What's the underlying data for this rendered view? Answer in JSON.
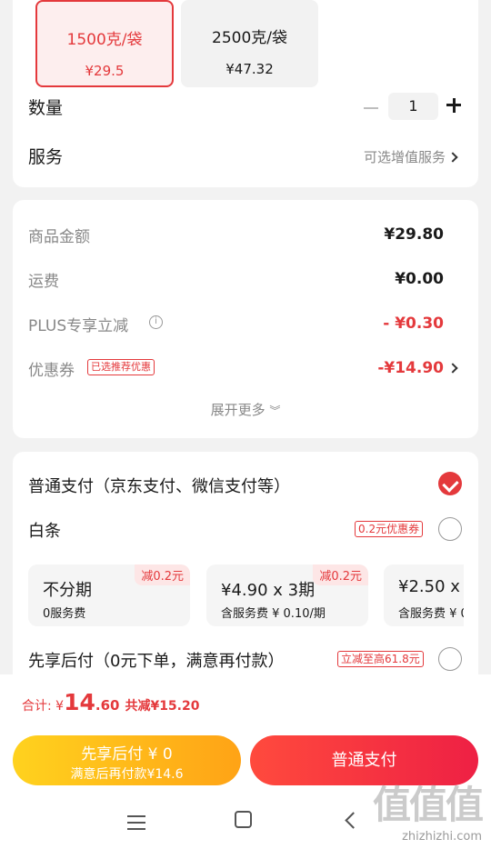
{
  "specs": [
    {
      "name": "1500克/袋",
      "price": "¥29.5",
      "selected": true
    },
    {
      "name": "2500克/袋",
      "price": "¥47.32",
      "selected": false
    }
  ],
  "quantity": {
    "label": "数量",
    "value": "1"
  },
  "service": {
    "label": "服务",
    "hint": "可选增值服务"
  },
  "price": {
    "goods_label": "商品金额",
    "goods_value": "¥29.80",
    "freight_label": "运费",
    "freight_value": "¥0.00",
    "plus_label": "PLUS专享立减",
    "plus_value": "- ¥0.30",
    "coupon_label": "优惠券",
    "coupon_tag": "已选推荐优惠",
    "coupon_value": "-¥14.90",
    "expand": "展开更多"
  },
  "payment": {
    "normal_label": "普通支付（京东支付、微信支付等）",
    "baitiao_label": "白条",
    "baitiao_tag": "0.2元优惠券",
    "installments": [
      {
        "title": "不分期",
        "sub": "0服务费",
        "badge": "减0.2元"
      },
      {
        "title": "¥4.90 x 3期",
        "sub": "含服务费 ¥ 0.10/期",
        "badge": "减0.2元"
      },
      {
        "title": "¥2.50 x",
        "sub": "含服务费 ¥ 0",
        "badge": ""
      }
    ],
    "later_label": "先享后付（0元下单，满意再付款）",
    "later_tag": "立减至高61.8元"
  },
  "footer": {
    "total_prefix": "合计: ¥",
    "total_int": "14",
    "total_dec": ".60",
    "saved": "共减¥15.20",
    "btn_later_l1": "先享后付 ¥ 0",
    "btn_later_l2": "满意后再付款¥14.6",
    "btn_pay": "普通支付"
  },
  "watermark": {
    "logo": "值值值",
    "url": "zhizhizhi.com"
  },
  "colors": {
    "accent": "#e4393c",
    "later_btn": "#ffb818",
    "pay_btn": "#f02d40"
  }
}
